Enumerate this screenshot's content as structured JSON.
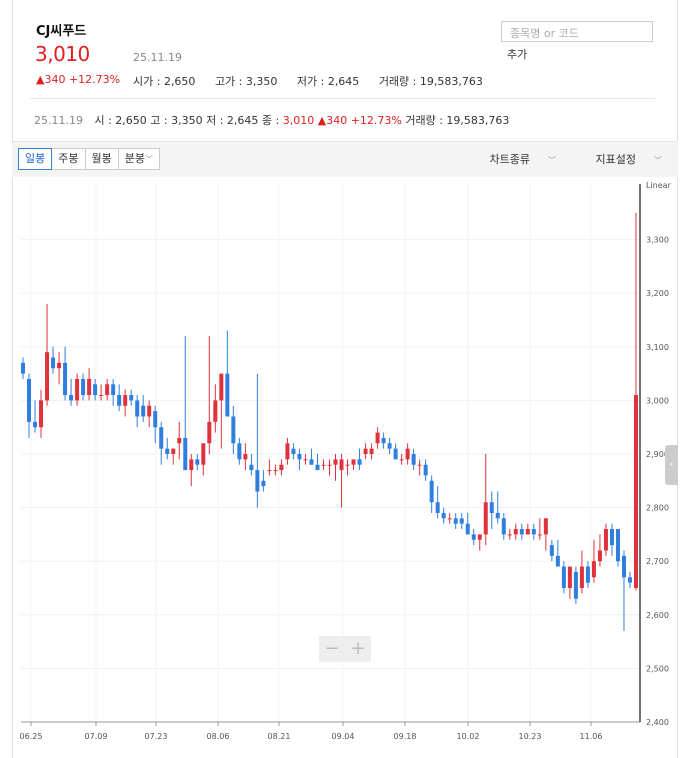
{
  "stock": {
    "name": "CJ씨푸드",
    "price": "3,010",
    "change": "▲340 +12.73%",
    "date": "25.11.19",
    "open": "시가 : 2,650",
    "high": "고가 : 3,350",
    "low": "저가 : 2,645",
    "volume": "거래량 : 19,583,763"
  },
  "search": {
    "placeholder": "종목명 or 코드",
    "add_label": "추가"
  },
  "summary": {
    "date": "25.11.19",
    "open": "시 : 2,650",
    "high": "고 : 3,350",
    "low": "저 : 2,645",
    "close_label": "종 :",
    "close": "3,010",
    "change": "▲340 +12.73%",
    "volume": "거래량 : 19,583,763"
  },
  "toolbar": {
    "tabs": [
      "일봉",
      "주봉",
      "월봉",
      "분봉"
    ],
    "chart_type": "차트종류",
    "indicators": "지표설정"
  },
  "zoom": {
    "minus": "−",
    "plus": "+"
  },
  "colors": {
    "up": "#e0323c",
    "down": "#2f7ee0",
    "accent": "#1a66c9"
  },
  "chart_data": {
    "type": "candlestick",
    "scale_label": "Linear",
    "ylim": [
      2400,
      3400
    ],
    "y_ticks": [
      "3,300",
      "3,200",
      "3,100",
      "3,000",
      "2,900",
      "2,800",
      "2,700",
      "2,600",
      "2,500",
      "2,400"
    ],
    "x_ticks": [
      "06.25",
      "07.09",
      "07.23",
      "08.06",
      "08.21",
      "09.04",
      "09.18",
      "10.02",
      "10.23",
      "11.06"
    ],
    "candles": [
      [
        3070,
        3080,
        3040,
        3050
      ],
      [
        3040,
        3050,
        2930,
        2960
      ],
      [
        2960,
        3000,
        2940,
        2950
      ],
      [
        2950,
        3020,
        2930,
        3000
      ],
      [
        3000,
        3180,
        2990,
        3090
      ],
      [
        3080,
        3100,
        3050,
        3060
      ],
      [
        3060,
        3090,
        3030,
        3070
      ],
      [
        3070,
        3100,
        3000,
        3010
      ],
      [
        3010,
        3040,
        2990,
        3000
      ],
      [
        3000,
        3050,
        2990,
        3040
      ],
      [
        3040,
        3050,
        3000,
        3010
      ],
      [
        3010,
        3060,
        3000,
        3040
      ],
      [
        3030,
        3040,
        3000,
        3010
      ],
      [
        3010,
        3030,
        3000,
        3010
      ],
      [
        3010,
        3040,
        3000,
        3030
      ],
      [
        3030,
        3040,
        2990,
        3010
      ],
      [
        3010,
        3030,
        2980,
        2990
      ],
      [
        2990,
        3020,
        2970,
        3010
      ],
      [
        3010,
        3020,
        2990,
        3000
      ],
      [
        3000,
        3010,
        2950,
        2970
      ],
      [
        2990,
        3010,
        2960,
        2970
      ],
      [
        2970,
        3000,
        2950,
        2990
      ],
      [
        2980,
        2990,
        2920,
        2950
      ],
      [
        2950,
        2960,
        2880,
        2910
      ],
      [
        2910,
        2930,
        2890,
        2900
      ],
      [
        2900,
        2910,
        2880,
        2910
      ],
      [
        2920,
        2960,
        2890,
        2930
      ],
      [
        2930,
        3120,
        2880,
        2870
      ],
      [
        2870,
        2900,
        2840,
        2890
      ],
      [
        2890,
        2900,
        2870,
        2880
      ],
      [
        2880,
        2910,
        2860,
        2920
      ],
      [
        2920,
        3120,
        2900,
        2960
      ],
      [
        2960,
        3030,
        2940,
        3000
      ],
      [
        3000,
        3000,
        2910,
        3050
      ],
      [
        3050,
        3130,
        2990,
        2970
      ],
      [
        2970,
        2990,
        2900,
        2920
      ],
      [
        2920,
        2930,
        2880,
        2890
      ],
      [
        2890,
        2920,
        2870,
        2900
      ],
      [
        2880,
        2900,
        2860,
        2870
      ],
      [
        2870,
        3050,
        2800,
        2830
      ],
      [
        2850,
        2870,
        2830,
        2840
      ],
      [
        2870,
        2890,
        2860,
        2870
      ],
      [
        2870,
        2880,
        2860,
        2870
      ],
      [
        2870,
        2890,
        2860,
        2880
      ],
      [
        2890,
        2930,
        2880,
        2920
      ],
      [
        2910,
        2920,
        2890,
        2900
      ],
      [
        2900,
        2910,
        2870,
        2890
      ],
      [
        2890,
        2900,
        2880,
        2890
      ],
      [
        2890,
        2910,
        2880,
        2880
      ],
      [
        2880,
        2900,
        2870,
        2870
      ],
      [
        2880,
        2890,
        2870,
        2880
      ],
      [
        2880,
        2890,
        2860,
        2880
      ],
      [
        2880,
        2900,
        2850,
        2890
      ],
      [
        2870,
        2900,
        2800,
        2890
      ],
      [
        2880,
        2890,
        2860,
        2880
      ],
      [
        2880,
        2890,
        2870,
        2890
      ],
      [
        2890,
        2910,
        2870,
        2880
      ],
      [
        2900,
        2920,
        2890,
        2910
      ],
      [
        2900,
        2920,
        2890,
        2910
      ],
      [
        2920,
        2950,
        2910,
        2940
      ],
      [
        2930,
        2940,
        2910,
        2920
      ],
      [
        2920,
        2930,
        2900,
        2910
      ],
      [
        2910,
        2920,
        2890,
        2890
      ],
      [
        2890,
        2900,
        2880,
        2890
      ],
      [
        2890,
        2920,
        2880,
        2910
      ],
      [
        2900,
        2910,
        2870,
        2880
      ],
      [
        2880,
        2890,
        2860,
        2880
      ],
      [
        2880,
        2890,
        2850,
        2860
      ],
      [
        2850,
        2860,
        2790,
        2810
      ],
      [
        2810,
        2840,
        2780,
        2790
      ],
      [
        2790,
        2800,
        2770,
        2780
      ],
      [
        2780,
        2790,
        2770,
        2780
      ],
      [
        2780,
        2790,
        2760,
        2770
      ],
      [
        2780,
        2790,
        2760,
        2770
      ],
      [
        2770,
        2790,
        2750,
        2750
      ],
      [
        2750,
        2760,
        2730,
        2740
      ],
      [
        2740,
        2750,
        2720,
        2750
      ],
      [
        2750,
        2900,
        2730,
        2810
      ],
      [
        2810,
        2830,
        2760,
        2790
      ],
      [
        2790,
        2830,
        2770,
        2780
      ],
      [
        2780,
        2790,
        2740,
        2750
      ],
      [
        2750,
        2760,
        2740,
        2750
      ],
      [
        2750,
        2770,
        2740,
        2760
      ],
      [
        2760,
        2770,
        2740,
        2750
      ],
      [
        2750,
        2770,
        2750,
        2760
      ],
      [
        2760,
        2770,
        2740,
        2750
      ],
      [
        2750,
        2780,
        2740,
        2750
      ],
      [
        2750,
        2780,
        2720,
        2780
      ],
      [
        2730,
        2740,
        2700,
        2710
      ],
      [
        2710,
        2740,
        2690,
        2690
      ],
      [
        2690,
        2700,
        2640,
        2650
      ],
      [
        2650,
        2690,
        2630,
        2690
      ],
      [
        2680,
        2690,
        2620,
        2630
      ],
      [
        2650,
        2720,
        2640,
        2690
      ],
      [
        2690,
        2700,
        2650,
        2660
      ],
      [
        2670,
        2740,
        2660,
        2700
      ],
      [
        2700,
        2750,
        2690,
        2720
      ],
      [
        2720,
        2770,
        2710,
        2760
      ],
      [
        2760,
        2770,
        2710,
        2730
      ],
      [
        2760,
        2760,
        2690,
        2700
      ],
      [
        2710,
        2720,
        2570,
        2670
      ],
      [
        2670,
        2680,
        2650,
        2660
      ],
      [
        2650,
        3350,
        2645,
        3010
      ]
    ]
  }
}
